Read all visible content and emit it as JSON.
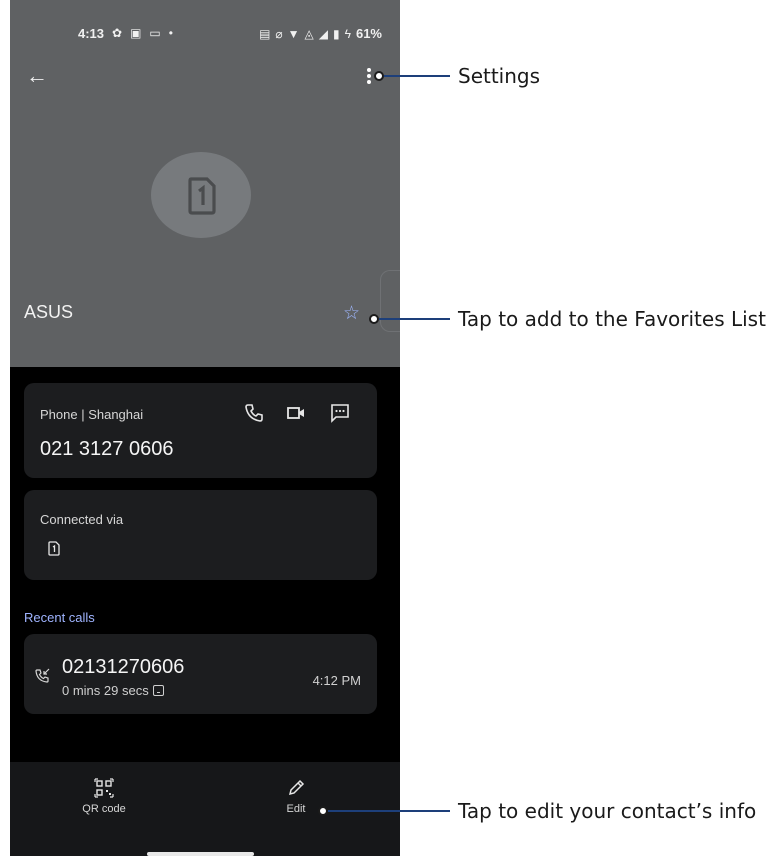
{
  "status_bar": {
    "time": "4:13",
    "battery": "61%"
  },
  "contact": {
    "name": "ASUS"
  },
  "phone_card": {
    "label": "Phone | Shanghai",
    "number": "021 3127 0606"
  },
  "connected_card": {
    "label": "Connected via"
  },
  "recent_calls": {
    "title": "Recent calls",
    "items": [
      {
        "number": "02131270606",
        "duration": "0 mins 29 secs",
        "time": "4:12 PM"
      }
    ]
  },
  "bottom_bar": {
    "qr_label": "QR code",
    "edit_label": "Edit"
  },
  "annotations": {
    "settings": "Settings",
    "favorites": "Tap to add to the Favorites List",
    "edit": "Tap to edit your contact’s info"
  },
  "colors": {
    "header_bg": "#5f6163",
    "card_bg": "#1c1d1f",
    "accent": "#9fb4ff",
    "annotation_line": "#1d3f7a"
  },
  "icons": [
    "back-arrow-icon",
    "more-vert-icon",
    "sim-card-icon",
    "star-outline-icon",
    "phone-icon",
    "video-icon",
    "message-icon",
    "incoming-call-icon",
    "qr-code-icon",
    "pencil-icon"
  ]
}
